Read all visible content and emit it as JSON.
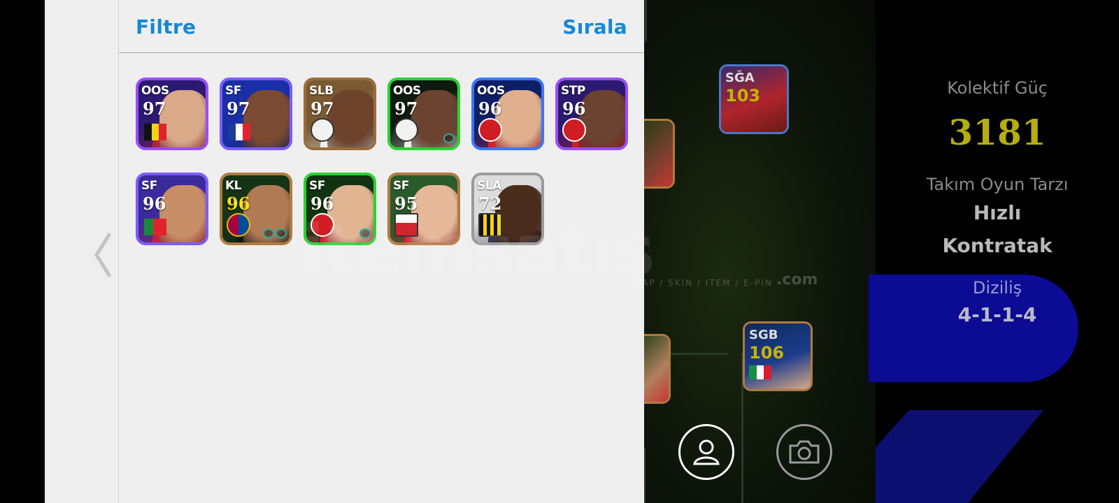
{
  "header": {
    "filter_label": "Filtre",
    "sort_label": "Sırala"
  },
  "players": [
    {
      "position": "OOS",
      "rating": "97",
      "border": "#9a4dff",
      "bg": "#2a1a70",
      "skin": "#d9a988",
      "kit": "#b3243b",
      "emblem": "flag-belgium-icon"
    },
    {
      "position": "SF",
      "rating": "97",
      "border": "#7b5cff",
      "bg": "#1a2ea6",
      "skin": "#7a4a32",
      "kit": "#1b2c8f",
      "emblem": "flag-france-icon"
    },
    {
      "position": "SLB",
      "rating": "97",
      "border": "#9a6b3c",
      "bg": "#7a5a32",
      "skin": "#6d432c",
      "kit": "#eeeeee",
      "emblem": "crest-icon"
    },
    {
      "position": "OOS",
      "rating": "97",
      "border": "#28d232",
      "bg": "#0f1a0f",
      "skin": "#6b4330",
      "kit": "#f1f1f1",
      "emblem": "crest-icon"
    },
    {
      "position": "OOS",
      "rating": "96",
      "border": "#3a76ff",
      "bg": "#0e1f66",
      "skin": "#e0b08e",
      "kit": "#d62025",
      "emblem": "crest-arsenal-icon"
    },
    {
      "position": "STP",
      "rating": "96",
      "border": "#9a4dff",
      "bg": "#2b1a70",
      "skin": "#6b4330",
      "kit": "#d01d24",
      "emblem": "crest-liverpool-icon"
    },
    {
      "position": "SF",
      "rating": "96",
      "border": "#7b5cff",
      "bg": "#3a2a9a",
      "skin": "#c88e68",
      "kit": "#c62237",
      "emblem": "flag-portugal-icon"
    },
    {
      "position": "KL",
      "rating": "96",
      "border": "#b07a40",
      "bg": "#153315",
      "skin": "#b07a55",
      "kit": "#0f1a0f",
      "emblem": "crest-barcelona-icon",
      "rating_gold": true
    },
    {
      "position": "SF",
      "rating": "96",
      "border": "#28d232",
      "bg": "#113311",
      "skin": "#e1b592",
      "kit": "#d61f2d",
      "emblem": "crest-bayern-icon"
    },
    {
      "position": "SF",
      "rating": "95",
      "border": "#b07a40",
      "bg": "#2a5a2a",
      "skin": "#e6b89a",
      "kit": "#d12330",
      "emblem": "crest-mdrw-icon"
    },
    {
      "position": "SLA",
      "rating": "72",
      "border": "#9a9a9a",
      "bg": "#dcdcdc",
      "skin": "#4a2c1d",
      "kit": "#1f2235",
      "emblem": "crest-stripes-icon"
    }
  ],
  "summary": {
    "power_label": "Kolektif Güç",
    "power_value": "3181",
    "style_label": "Takım Oyun Tarzı",
    "style_value_1": "Hızlı",
    "style_value_2": "Kontratak",
    "formation_label": "Diziliş",
    "formation_value": "4-1-1-4"
  },
  "bg_cards": [
    {
      "position": "SĞA",
      "rating": "103"
    },
    {
      "position": "SGB",
      "rating": "106"
    }
  ],
  "watermark": {
    "main": "itemsatış",
    "sub": "AP / SKIN / ITEM / E-PIN",
    "suffix": ".com"
  }
}
